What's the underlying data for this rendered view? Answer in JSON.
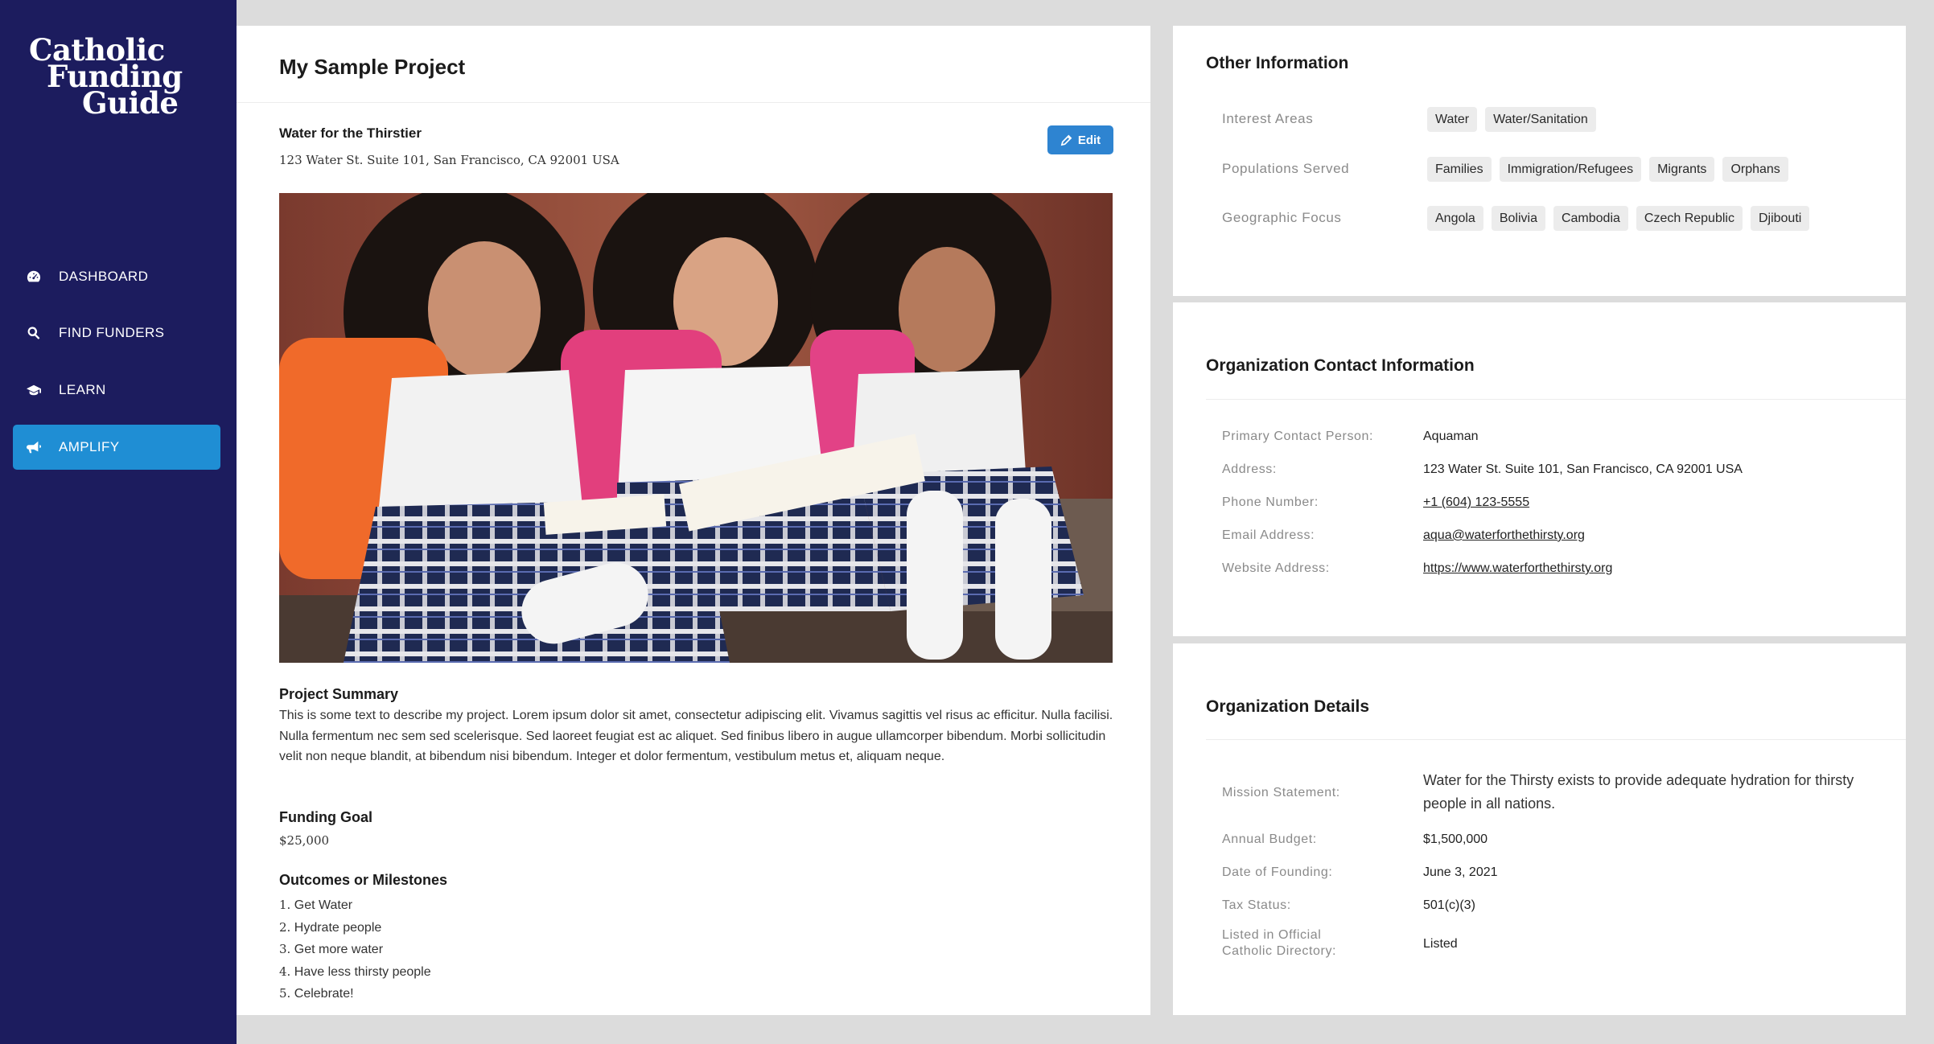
{
  "brand": {
    "line1": "Catholic",
    "line2": "Funding",
    "line3": "Guide"
  },
  "nav": [
    {
      "label": "DASHBOARD",
      "icon": "dashboard-icon"
    },
    {
      "label": "FIND FUNDERS",
      "icon": "search-icon"
    },
    {
      "label": "LEARN",
      "icon": "graduation-cap-icon"
    },
    {
      "label": "AMPLIFY",
      "icon": "megaphone-icon",
      "active": true
    }
  ],
  "project": {
    "title": "My Sample Project",
    "org_name": "Water for the Thirstier",
    "org_address": "123 Water St. Suite 101, San Francisco, CA 92001 USA",
    "edit_label": "Edit",
    "summary_heading": "Project Summary",
    "summary_text": "This is some text to describe my project. Lorem ipsum dolor sit amet, consectetur adipiscing elit. Vivamus sagittis vel risus ac efficitur. Nulla facilisi. Nulla fermentum nec sem sed scelerisque. Sed laoreet feugiat est ac aliquet. Sed finibus libero in augue ullamcorper bibendum. Morbi sollicitudin velit non neque blandit, at bibendum nisi bibendum. Integer et dolor fermentum, vestibulum metus et, aliquam neque.",
    "goal_heading": "Funding Goal",
    "goal_value": "$25,000",
    "milestones_heading": "Outcomes or Milestones",
    "milestones": [
      {
        "num": "1.",
        "text": "Get Water"
      },
      {
        "num": "2.",
        "text": "Hydrate people"
      },
      {
        "num": "3.",
        "text": "Get more water"
      },
      {
        "num": "4.",
        "text": "Have less thirsty people"
      },
      {
        "num": "5.",
        "text": "Celebrate!"
      }
    ]
  },
  "other_info": {
    "title": "Other Information",
    "interest_label": "Interest Areas",
    "interest_tags": [
      "Water",
      "Water/Sanitation"
    ],
    "populations_label": "Populations Served",
    "populations_tags": [
      "Families",
      "Immigration/Refugees",
      "Migrants",
      "Orphans"
    ],
    "geo_label": "Geographic Focus",
    "geo_tags": [
      "Angola",
      "Bolivia",
      "Cambodia",
      "Czech Republic",
      "Djibouti"
    ]
  },
  "contact": {
    "title": "Organization Contact Information",
    "primary_label": "Primary Contact Person:",
    "primary_value": "Aquaman",
    "address_label": "Address:",
    "address_value": "123 Water St. Suite 101, San Francisco, CA 92001 USA",
    "phone_label": "Phone Number:",
    "phone_value": "+1 (604) 123-5555",
    "email_label": "Email Address:",
    "email_value": "aqua@waterforthethirsty.org",
    "website_label": "Website Address:",
    "website_value": "https://www.waterforthethirsty.org"
  },
  "details": {
    "title": "Organization Details",
    "mission_label": "Mission Statement:",
    "mission_value": "Water for the Thirsty exists to provide adequate hydration for thirsty people in all nations.",
    "budget_label": "Annual Budget:",
    "budget_value": "$1,500,000",
    "founding_label": "Date of Founding:",
    "founding_value": "June 3, 2021",
    "tax_label": "Tax Status:",
    "tax_value": "501(c)(3)",
    "listed_label_1": "Listed in Official",
    "listed_label_2": "Catholic Directory:",
    "listed_value": "Listed"
  },
  "colors": {
    "sidebar": "#1c1c5e",
    "accent": "#1f8ed4",
    "edit_button": "#2e84d1"
  }
}
